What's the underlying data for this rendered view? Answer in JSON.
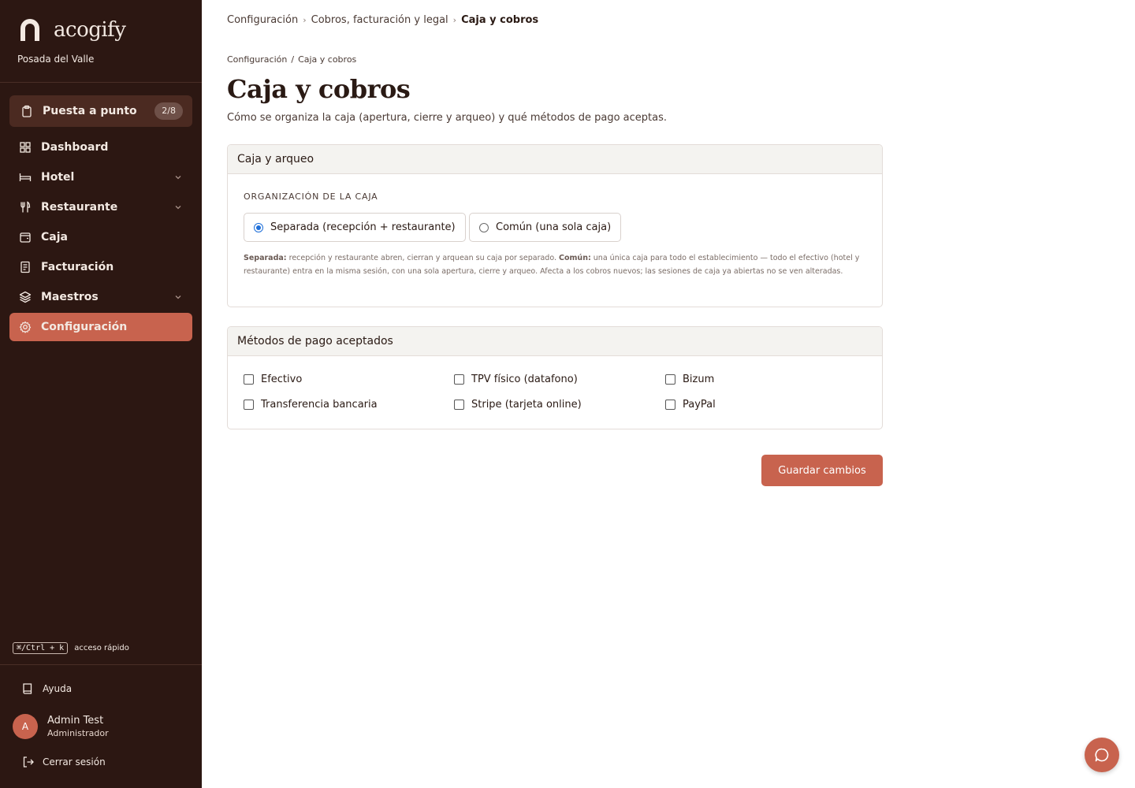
{
  "sidebar": {
    "brand": "acogify",
    "hotel": "Posada del Valle",
    "setup": {
      "label": "Puesta a punto",
      "count": "2/8"
    },
    "items": [
      {
        "label": "Dashboard",
        "icon": "grid-icon"
      },
      {
        "label": "Hotel",
        "icon": "bed-icon",
        "expandable": true
      },
      {
        "label": "Restaurante",
        "icon": "cutlery-icon",
        "expandable": true
      },
      {
        "label": "Caja",
        "icon": "wallet-icon"
      },
      {
        "label": "Facturación",
        "icon": "receipt-icon"
      },
      {
        "label": "Maestros",
        "icon": "layers-icon",
        "expandable": true
      },
      {
        "label": "Configuración",
        "icon": "gear-icon",
        "active": true
      }
    ],
    "shortcut": {
      "key": "⌘/Ctrl + k",
      "text": "acceso rápido"
    },
    "help": "Ayuda",
    "user": {
      "initial": "A",
      "name": "Admin Test",
      "role": "Administrador"
    },
    "logout": "Cerrar sesión"
  },
  "breadcrumb": [
    "Configuración",
    "Cobros, facturación y legal",
    "Caja y cobros"
  ],
  "subcrumb": [
    "Configuración",
    "Caja y cobros"
  ],
  "page": {
    "title": "Caja y cobros",
    "subtitle": "Cómo se organiza la caja (apertura, cierre y arqueo) y qué métodos de pago aceptas."
  },
  "caja_card": {
    "title": "Caja y arqueo",
    "section_label": "ORGANIZACIÓN DE LA CAJA",
    "options": [
      {
        "label": "Separada (recepción + restaurante)",
        "selected": true
      },
      {
        "label": "Común (una sola caja)",
        "selected": false
      }
    ],
    "help_lead_1": "Separada:",
    "help_text_1": " recepción y restaurante abren, cierran y arquean su caja por separado. ",
    "help_lead_2": "Común:",
    "help_text_2": " una única caja para todo el establecimiento — todo el efectivo (hotel y restaurante) entra en la misma sesión, con una sola apertura, cierre y arqueo. Afecta a los cobros nuevos; las sesiones de caja ya abiertas no se ven alteradas."
  },
  "payments_card": {
    "title": "Métodos de pago aceptados",
    "methods": [
      {
        "label": "Efectivo",
        "checked": false
      },
      {
        "label": "TPV físico (datafono)",
        "checked": false
      },
      {
        "label": "Bizum",
        "checked": false
      },
      {
        "label": "Transferencia bancaria",
        "checked": false
      },
      {
        "label": "Stripe (tarjeta online)",
        "checked": false
      },
      {
        "label": "PayPal",
        "checked": false
      }
    ]
  },
  "save_label": "Guardar cambios",
  "colors": {
    "sidebar_bg": "#2c1712",
    "accent": "#c8634e"
  }
}
